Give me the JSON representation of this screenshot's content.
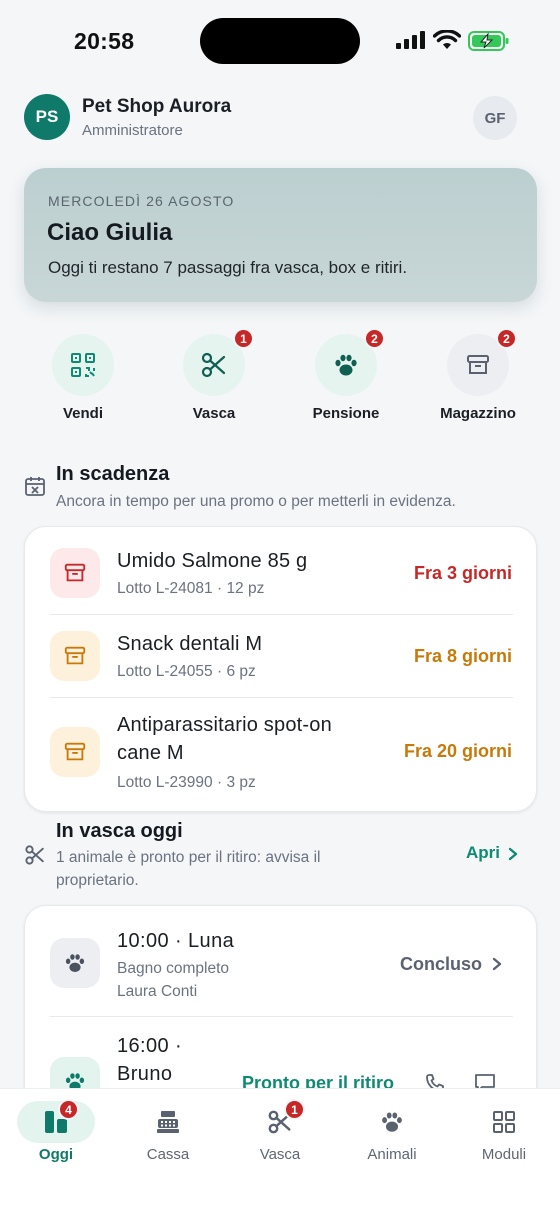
{
  "status_bar": {
    "time": "20:58"
  },
  "header": {
    "avatar_initials": "PS",
    "shop_name": "Pet Shop Aurora",
    "role": "Amministratore",
    "user_initials": "GF"
  },
  "greeting": {
    "date": "MERCOLEDÌ 26 AGOSTO",
    "title": "Ciao Giulia",
    "subtitle": "Oggi ti restano 7 passaggi fra vasca, box e ritiri."
  },
  "quick_actions": [
    {
      "label": "Vendi",
      "icon": "qr-code-icon",
      "badge": null
    },
    {
      "label": "Vasca",
      "icon": "scissors-icon",
      "badge": "1"
    },
    {
      "label": "Pensione",
      "icon": "paw-icon",
      "badge": "2"
    },
    {
      "label": "Magazzino",
      "icon": "archive-box-icon",
      "badge": "2"
    }
  ],
  "expiring": {
    "title": "In scadenza",
    "subtitle": "Ancora in tempo per una promo o per metterli in evidenza.",
    "items": [
      {
        "name": "Umido Salmone 85 g",
        "name_line2": "",
        "lot": "Lotto L-24081 · 12 pz",
        "due": "Fra 3 giorni",
        "color": "#c62828"
      },
      {
        "name": "Snack dentali M",
        "name_line2": "",
        "lot": "Lotto L-24055 · 6 pz",
        "due": "Fra 8 giorni",
        "color": "#c77a0a"
      },
      {
        "name": "Antiparassitario spot-on",
        "name_line2": "cane M",
        "lot": "Lotto L-23990 · 3 pz",
        "due": "Fra 20 giorni",
        "color": "#c77a0a"
      }
    ]
  },
  "grooming": {
    "title": "In vasca oggi",
    "subtitle_line1": "1 animale è pronto per il ritiro: avvisa il",
    "subtitle_line2": "proprietario.",
    "open_label": "Apri",
    "appointments": [
      {
        "time_name": "10:00  ·  Luna",
        "service": "Bagno completo",
        "owner": "Laura Conti",
        "status": "Concluso"
      },
      {
        "time_name": "16:00  ·",
        "name": "Bruno",
        "status": "Pronto per il ritiro"
      }
    ]
  },
  "tabs": [
    {
      "label": "Oggi",
      "icon": "dashboard-icon",
      "badge": "4",
      "active": true
    },
    {
      "label": "Cassa",
      "icon": "cash-register-icon",
      "badge": null
    },
    {
      "label": "Vasca",
      "icon": "scissors-icon",
      "badge": "1"
    },
    {
      "label": "Animali",
      "icon": "paw-icon",
      "badge": null
    },
    {
      "label": "Moduli",
      "icon": "grid-icon",
      "badge": null
    }
  ],
  "colors": {
    "brand": "#0f7a6a",
    "accent_green": "#0f8a73",
    "danger": "#c62828",
    "warning": "#c77a0a",
    "muted": "#6b7380"
  }
}
